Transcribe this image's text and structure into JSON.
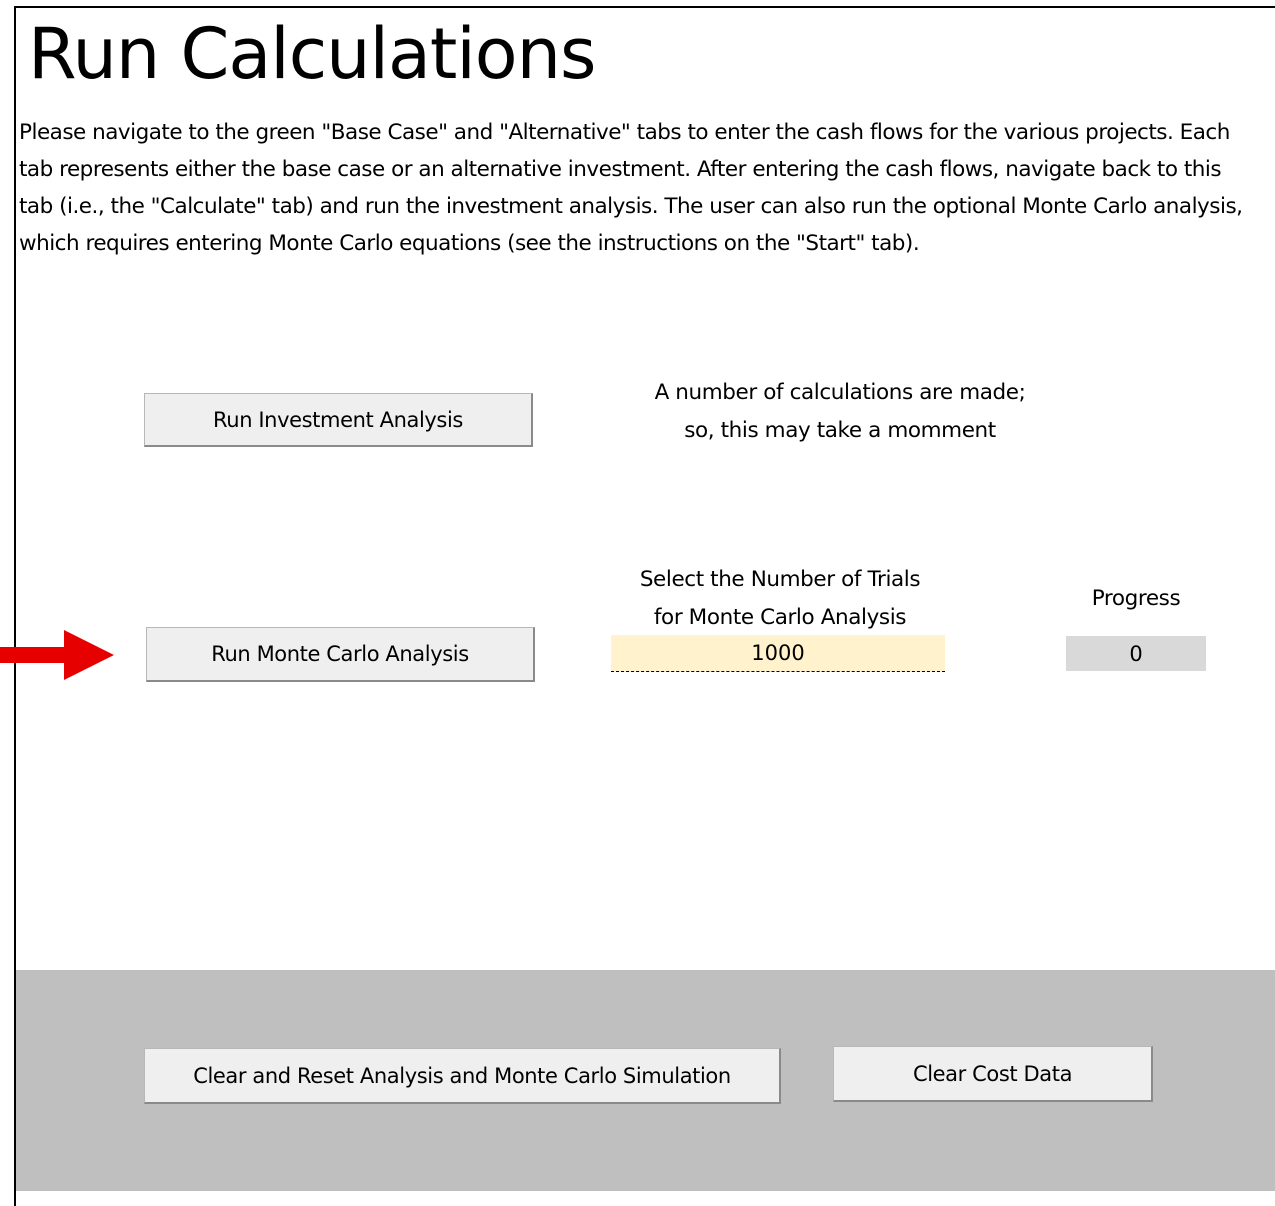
{
  "page": {
    "title": "Run Calculations",
    "description": "Please navigate to the green \"Base Case\" and \"Alternative\" tabs to enter the cash flows for the various projects. Each tab represents either the base case or an alternative investment. After entering the cash flows, navigate back to this tab (i.e., the \"Calculate\" tab) and run the investment analysis. The user can also run the optional Monte Carlo analysis, which requires entering Monte Carlo equations (see the instructions on the \"Start\" tab)."
  },
  "investment": {
    "button_label": "Run Investment Analysis",
    "note_line1": "A number of calculations are made;",
    "note_line2": "so, this may take a momment"
  },
  "monte_carlo": {
    "button_label": "Run Monte Carlo Analysis",
    "trials_label_line1": "Select the Number of Trials",
    "trials_label_line2": "for Monte Carlo Analysis",
    "trials_value": "1000",
    "progress_label": "Progress",
    "progress_value": "0"
  },
  "footer": {
    "clear_reset_label": "Clear and Reset Analysis and Monte Carlo Simulation",
    "clear_cost_label": "Clear Cost Data"
  },
  "colors": {
    "arrow": "#e60000",
    "input_fill": "#fff2cc",
    "progress_fill": "#d9d9d9",
    "footer_fill": "#bfbfbf"
  },
  "icons": {
    "pointer_arrow": "right-arrow-icon"
  }
}
